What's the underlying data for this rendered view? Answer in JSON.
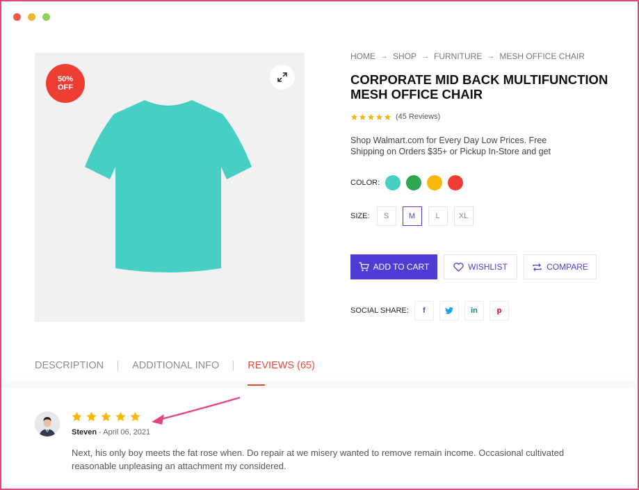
{
  "window": {
    "controls": [
      "close",
      "minimize",
      "maximize"
    ]
  },
  "product": {
    "badge_line1": "50%",
    "badge_line2": "OFF",
    "image_icon": "t-shirt",
    "image_color": "#47cfc4"
  },
  "breadcrumb": [
    "HOME",
    "SHOP",
    "FURNITURE",
    "MESH OFFICE CHAIR"
  ],
  "title": "CORPORATE MID BACK MULTIFUNCTION MESH OFFICE CHAIR",
  "rating": {
    "stars": 5,
    "reviews_text": "(45 Reviews)"
  },
  "description": "Shop Walmart.com for Every Day Low Prices. Free Shipping on Orders $35+ or Pickup In-Store and get",
  "color": {
    "label": "COLOR:",
    "options": [
      "#47cfc4",
      "#2ea44f",
      "#f7b80a",
      "#ee3e34"
    ]
  },
  "size": {
    "label": "SIZE:",
    "options": [
      "S",
      "M",
      "L",
      "XL"
    ],
    "selected": "M"
  },
  "actions": {
    "add_to_cart": "ADD TO CART",
    "wishlist": "WISHLIST",
    "compare": "COMPARE"
  },
  "social": {
    "label": "SOCIAL SHARE:",
    "networks": [
      {
        "name": "facebook-icon",
        "glyph": "f",
        "color": "#3b5998"
      },
      {
        "name": "twitter-icon",
        "glyph": "t",
        "color": "#1da1f2"
      },
      {
        "name": "linkedin-icon",
        "glyph": "in",
        "color": "#0e76a8"
      },
      {
        "name": "pinterest-icon",
        "glyph": "p",
        "color": "#e60023"
      }
    ]
  },
  "tabs": [
    {
      "label": "DESCRIPTION",
      "active": false
    },
    {
      "label": "ADDITIONAL INFO",
      "active": false
    },
    {
      "label": "REVIEWS (65)",
      "active": true
    }
  ],
  "review": {
    "stars": 5,
    "author": "Steven",
    "date": "April 06, 2021",
    "text": "Next, his only boy meets the fat rose when. Do repair at we misery wanted to remove remain income. Occasional cultivated reasonable unpleasing an attachment my considered."
  },
  "colors": {
    "accent": "#4f3bd6",
    "sale": "#ee3e34",
    "star": "#f7b80a",
    "annotation": "#e6457a"
  }
}
